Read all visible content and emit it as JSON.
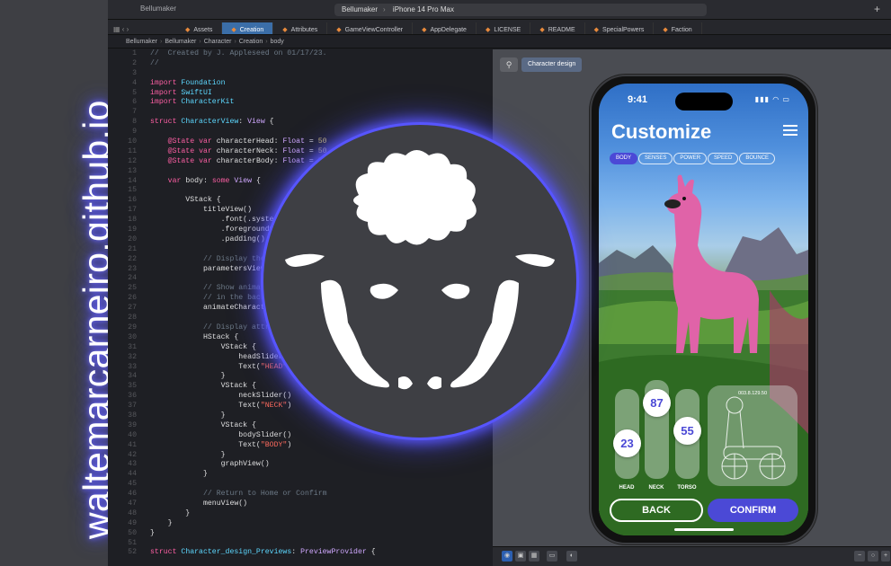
{
  "brand": {
    "text": "waltemarcarneiro.github.io"
  },
  "xcode": {
    "project": "Bellumaker",
    "scheme": {
      "project": "Bellumaker",
      "device": "iPhone 14 Pro Max"
    },
    "tabs": [
      "Assets",
      "Creation",
      "Attributes",
      "GameViewController",
      "AppDelegate",
      "LICENSE",
      "README",
      "SpecialPowers",
      "Faction"
    ],
    "active_tab": "Creation",
    "breadcrumbs": [
      "Bellumaker",
      "Bellumaker",
      "Character",
      "Creation",
      "body"
    ],
    "line_numbers": [
      1,
      2,
      3,
      4,
      5,
      6,
      7,
      8,
      9,
      10,
      11,
      12,
      13,
      14,
      15,
      16,
      17,
      18,
      19,
      20,
      21,
      22,
      23,
      24,
      25,
      26,
      27,
      28,
      29,
      30,
      31,
      32,
      33,
      34,
      35,
      36,
      37,
      38,
      39,
      40,
      41,
      42,
      43,
      44,
      45,
      46,
      47,
      48,
      49,
      50,
      51,
      52
    ],
    "code": [
      "//  Created by J. Appleseed on 01/17/23.",
      "//",
      "",
      "import Foundation",
      "import SwiftUI",
      "import CharacterKit",
      "",
      "struct CharacterView: View {",
      "",
      "    @State var characterHead: Float = 50",
      "    @State var characterNeck: Float = 50",
      "    @State var characterBody: Float = 5",
      "",
      "    var body: some View {",
      "",
      "        VStack {",
      "            titleView()",
      "                .font(.system",
      "                .foregroundC",
      "                .padding()",
      "",
      "            // Display the",
      "            parametersView",
      "",
      "            // Show animat",
      "            // in the back",
      "            animateCharacte",
      "",
      "            // Display attri",
      "            HStack {",
      "                VStack {",
      "                    headSlider(",
      "                    Text(\"HEAD\")",
      "                }",
      "                VStack {",
      "                    neckSlider()",
      "                    Text(\"NECK\")",
      "                }",
      "                VStack {",
      "                    bodySlider()",
      "                    Text(\"BODY\")",
      "                }",
      "                graphView()",
      "            }",
      "",
      "            // Return to Home or Confirm",
      "            menuView()",
      "        }",
      "    }",
      "}",
      "",
      "struct Character_design_Previews: PreviewProvider {"
    ]
  },
  "canvas": {
    "tag": "Character design"
  },
  "phone": {
    "time": "9:41",
    "title": "Customize",
    "chips": [
      "BODY",
      "SENSES",
      "POWER",
      "SPEED",
      "BOUNCE"
    ],
    "selected_chip": "BODY",
    "sliders": [
      {
        "label": "HEAD",
        "value": "23",
        "fraction": 0.35
      },
      {
        "label": "NECK",
        "value": "87",
        "fraction": 0.87
      },
      {
        "label": "TORSO",
        "value": "55",
        "fraction": 0.55
      }
    ],
    "graph_readout": "003.8.129.50",
    "back_label": "BACK",
    "confirm_label": "CONFIRM"
  },
  "colors": {
    "accent": "#4b49d6",
    "glow": "#5755ff",
    "logo_bg": "#3e3f44"
  }
}
